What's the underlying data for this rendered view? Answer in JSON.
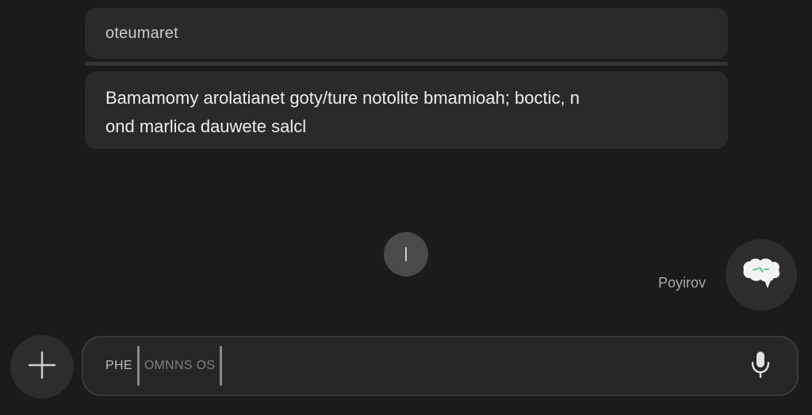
{
  "header_card": {
    "text": "oteumaret"
  },
  "message": {
    "line1": "Bamamomy arolatianet goty/ture notolite bmamioah; boctic, n",
    "line2": "ond marlica dauwete salcl"
  },
  "assistant": {
    "label": "Poyirov"
  },
  "composer": {
    "chip_label": "PHE",
    "input_value": "OMNNS OS"
  },
  "icons": {
    "scroll": "scroll-down-icon",
    "assistant": "assistant-bubble-icon",
    "add": "plus-icon",
    "mic": "microphone-icon"
  },
  "colors": {
    "background": "#1b1b1c",
    "card": "#2a2a2b",
    "assistant_accent": "#2fbf71"
  }
}
